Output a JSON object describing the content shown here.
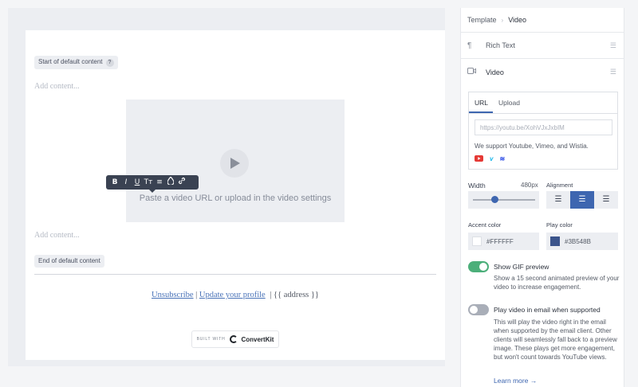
{
  "editor": {
    "start_label": "Start of default content",
    "help_icon": "?",
    "add_content_top": "Add content...",
    "video_placeholder": "Paste a video URL or upload in the video settings",
    "add_content_bottom": "Add content...",
    "end_label": "End of default content",
    "toolbar": [
      "B",
      "I",
      "U",
      "Tт",
      "≡",
      "◈",
      "🔗"
    ],
    "footer": {
      "unsubscribe": "Unsubscribe",
      "separator": "|",
      "update_profile": "Update your profile",
      "address": "| {{ address }}"
    },
    "built_with": "BUILT WITH",
    "brand": "ConvertKit"
  },
  "panel": {
    "breadcrumb": {
      "parent": "Template",
      "sep": "›",
      "current": "Video"
    },
    "blocks": [
      {
        "label": "Rich Text",
        "icon": "paragraph-icon"
      },
      {
        "label": "Video",
        "icon": "video-icon"
      }
    ],
    "tabs": [
      "URL",
      "Upload"
    ],
    "url_placeholder": "https://youtu.be/XohVJxJxbIM",
    "support_text": "We support Youtube, Vimeo, and Wistia.",
    "width_label": "Width",
    "width_value": "480px",
    "width_fraction": 0.35,
    "alignment_label": "Alignment",
    "accent_label": "Accent color",
    "accent_value": "#FFFFFF",
    "play_label": "Play color",
    "play_value": "#3B548B",
    "gif_title": "Show GIF preview",
    "gif_desc": "Show a 15 second animated preview of your video to increase engagement.",
    "gif_on": true,
    "play_email_title": "Play video in email when supported",
    "play_email_desc": "This will play the video right in the email when supported by the email client. Other clients will seamlessly fall back to a preview image. These plays get more engagement, but won't count towards YouTube views.",
    "play_email_on": false,
    "learn_more": "Learn more →"
  },
  "colors": {
    "accent_swatch": "#FFFFFF",
    "play_swatch": "#3B548B",
    "toggle_on": "#4caf7a",
    "toggle_off": "#a9aeb8",
    "brand_blue": "#3e66b0"
  }
}
